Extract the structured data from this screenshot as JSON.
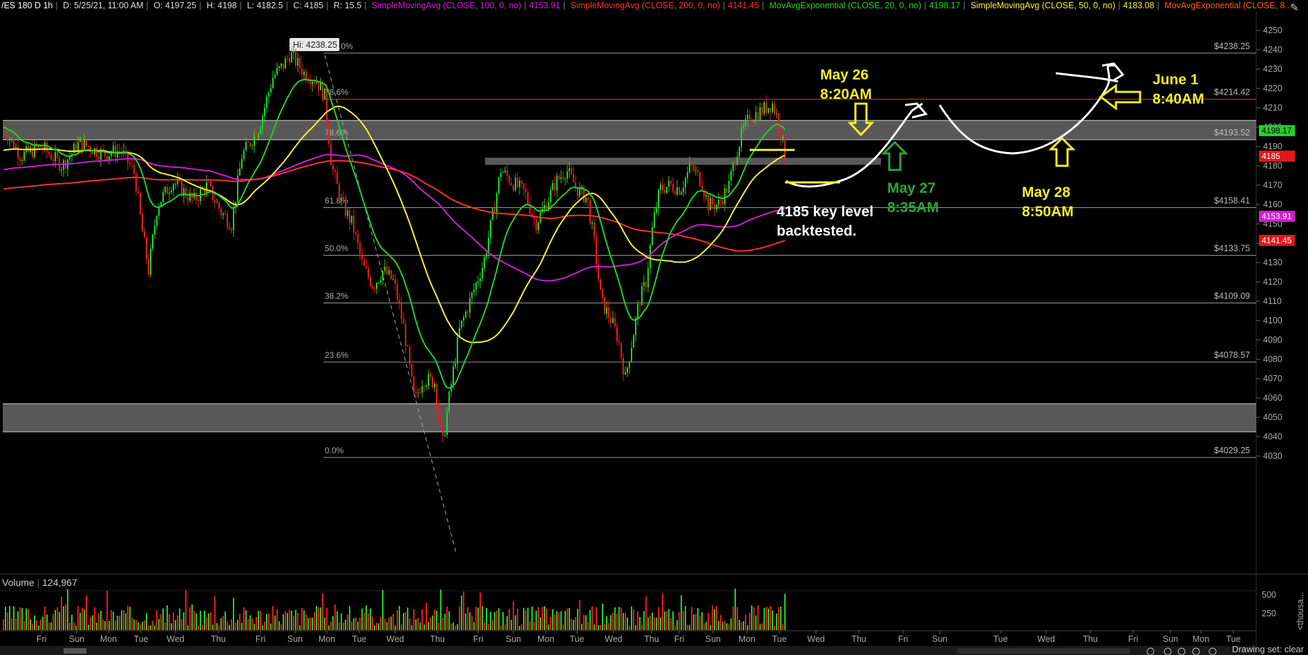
{
  "header": {
    "symbol": "/ES 180 D 1h",
    "date": "D: 5/25/21, 11:00 AM",
    "open": "O: 4197.25",
    "high": "H: 4198",
    "low": "L: 4182.5",
    "close": "C: 4185",
    "range": "R: 15.5",
    "studies": [
      {
        "name": "SimpleMovingAvg (CLOSE, 100, 0, no)",
        "value": "4153.91",
        "color": "#d21cd6"
      },
      {
        "name": "SimpleMovingAvg (CLOSE, 200, 0, no)",
        "value": "4141.45",
        "color": "#ff3030"
      },
      {
        "name": "MovAvgExponential (CLOSE, 20, 0, no)",
        "value": "4198.17",
        "color": "#22d12a"
      },
      {
        "name": "SimpleMovingAvg (CLOSE, 50, 0, no)",
        "value": "4183.08",
        "color": "#f6f23a"
      },
      {
        "name": "MovAvgExponential (CLOSE, 8...",
        "value": "",
        "color": "#ff5a1a"
      }
    ]
  },
  "chart_data": {
    "type": "candlestick",
    "y_ticks": [
      4030,
      4040,
      4050,
      4060,
      4070,
      4080,
      4090,
      4100,
      4110,
      4120,
      4130,
      4140,
      4150,
      4160,
      4170,
      4180,
      4190,
      4200,
      4210,
      4220,
      4230,
      4240,
      4250
    ],
    "ylim": [
      4025,
      4255
    ],
    "x_labels": [
      "Fri",
      "Sun",
      "Mon",
      "Tue",
      "Wed",
      "Thu",
      "Fri",
      "Sun",
      "Mon",
      "Tue",
      "Wed",
      "Thu",
      "Fri",
      "Sun",
      "Mon",
      "Tue",
      "Wed",
      "Thu",
      "Fri",
      "Sun",
      "Mon",
      "Tue",
      "Wed",
      "Thu",
      "Fri",
      "Sun",
      "Tue",
      "Wed",
      "Thu",
      "Fri",
      "Sun",
      "Mon",
      "Tue"
    ],
    "highlighted_x_label": "Thu",
    "hi_label": "Hi: 4238.25",
    "fib_levels": [
      {
        "pct": "100.0%",
        "price": "$4238.25",
        "value": 4238.25
      },
      {
        "pct": "78.6%",
        "price": "$4214.42",
        "value": 4214.42,
        "color": "#e03c3c"
      },
      {
        "pct": "78.6%",
        "price": "$4193.52",
        "value": 4193.52
      },
      {
        "pct": "61.8%",
        "price": "$4158.41",
        "value": 4158.41
      },
      {
        "pct": "50.0%",
        "price": "$4133.75",
        "value": 4133.75
      },
      {
        "pct": "38.2%",
        "price": "$4109.09",
        "value": 4109.09
      },
      {
        "pct": "23.6%",
        "price": "$4078.57",
        "value": 4078.57
      },
      {
        "pct": "0.0%",
        "price": "$4029.25",
        "value": 4029.25
      }
    ],
    "price_tags": [
      {
        "value": "4198.17",
        "y": 4198.17,
        "color": "#22d12a"
      },
      {
        "value": "4185",
        "y": 4185,
        "color": "#e01818"
      },
      {
        "value": "4153.91",
        "y": 4153.91,
        "color": "#d21cd6"
      },
      {
        "value": "4141.45",
        "y": 4141.45,
        "color": "#e01818"
      }
    ],
    "zones": [
      {
        "from": 4193.5,
        "to": 4203.5
      },
      {
        "from": 4180.5,
        "to": 4184.2
      },
      {
        "from": 4042.5,
        "to": 4057
      }
    ],
    "volume_ticks": [
      "500",
      "250"
    ],
    "volume_unit": "<thousa..."
  },
  "annotations": [
    {
      "line1": "May 26",
      "line2": "8:20AM",
      "color": "#f4ef2a"
    },
    {
      "line1": "May 27",
      "line2": "8:35AM",
      "color": "#27a83a"
    },
    {
      "line1": "May 28",
      "line2": "8:50AM",
      "color": "#f4ef2a"
    },
    {
      "line1": "June 1",
      "line2": "8:40AM",
      "color": "#f4ef2a"
    },
    {
      "line1": "4185 key level",
      "line2": "backtested.",
      "color": "#ffffff"
    }
  ],
  "volume": {
    "label": "Volume",
    "value": "124,967"
  },
  "footer": {
    "drawing_set": "Drawing set: clear"
  }
}
